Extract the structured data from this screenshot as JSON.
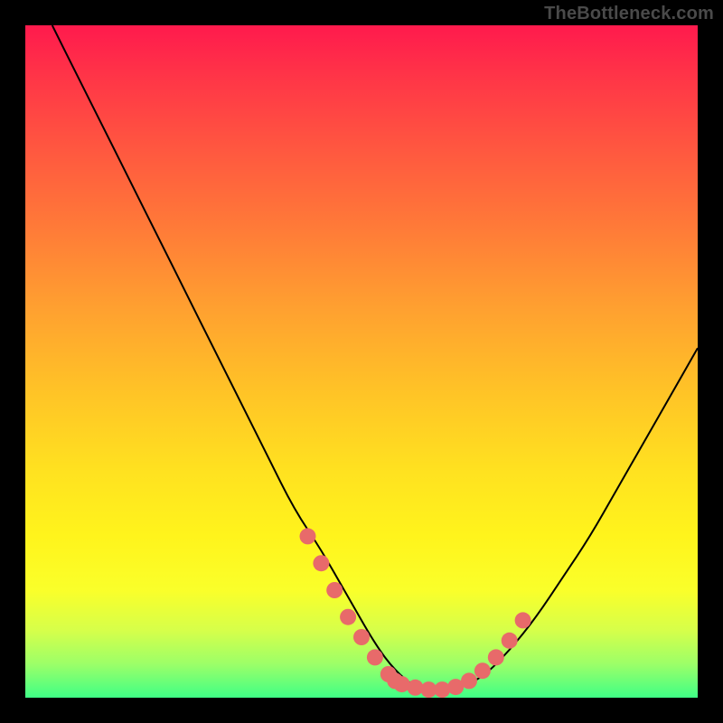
{
  "watermark": "TheBottleneck.com",
  "chart_data": {
    "type": "line",
    "title": "",
    "xlabel": "",
    "ylabel": "",
    "xlim": [
      0,
      100
    ],
    "ylim": [
      0,
      100
    ],
    "grid": false,
    "legend": false,
    "series": [
      {
        "name": "bottleneck-curve",
        "x": [
          4,
          8,
          12,
          16,
          20,
          24,
          28,
          32,
          36,
          40,
          44,
          48,
          52,
          55,
          58,
          61,
          64,
          68,
          72,
          76,
          80,
          84,
          88,
          92,
          96,
          100
        ],
        "y": [
          100,
          92,
          84,
          76,
          68,
          60,
          52,
          44,
          36,
          28,
          22,
          15,
          8,
          4,
          1.5,
          1,
          1.2,
          3,
          7,
          12,
          18,
          24,
          31,
          38,
          45,
          52
        ]
      }
    ],
    "markers": {
      "name": "highlight-band",
      "color": "#e86a6a",
      "x": [
        42,
        44,
        46,
        48,
        50,
        52,
        54,
        55,
        56,
        58,
        60,
        62,
        64,
        66,
        68,
        70,
        72,
        74
      ],
      "y": [
        24,
        20,
        16,
        12,
        9,
        6,
        3.5,
        2.5,
        2,
        1.5,
        1.2,
        1.2,
        1.6,
        2.5,
        4,
        6,
        8.5,
        11.5
      ]
    },
    "background_gradient": {
      "top_color": "#ff1a4d",
      "bottom_color": "#3fff86"
    }
  }
}
